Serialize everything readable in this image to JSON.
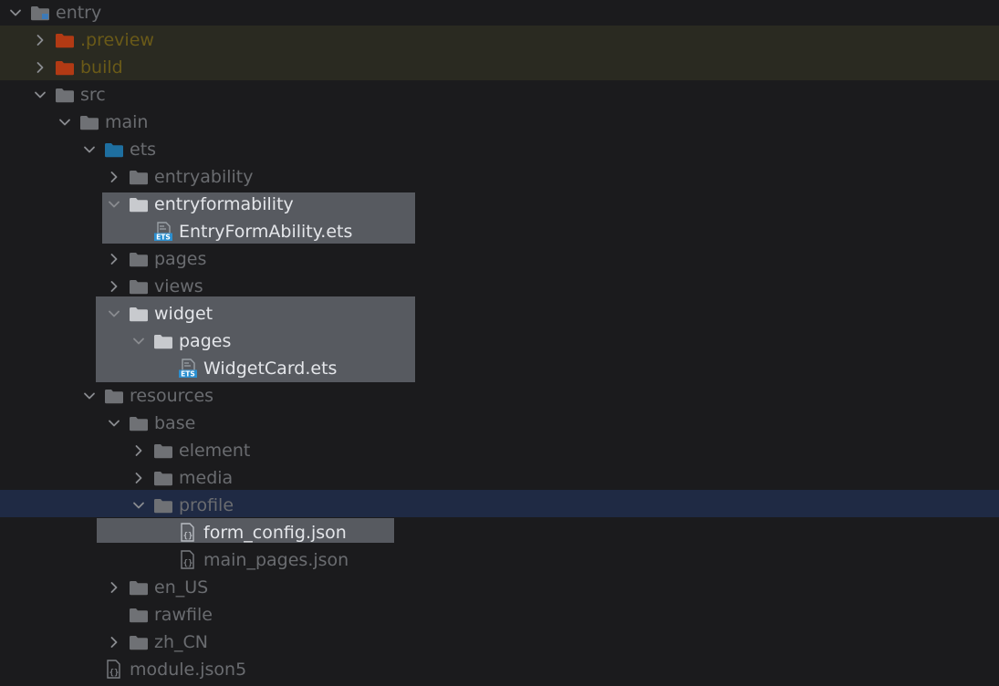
{
  "colors": {
    "background": "#1b1b1d",
    "excluded_band": "#2a2a21",
    "selected_row": "#1f2a44",
    "highlight_box": "#5c5f66",
    "text_dim": "#6a6c70",
    "text_bright": "#e4e6ea",
    "folder_grey": "#6f7175",
    "folder_blue": "#1e6fa0",
    "folder_orange": "#b23a14",
    "ets_badge": "#2b8fd0"
  },
  "tree": [
    {
      "label": "entry",
      "chevron": "down",
      "icon": "module-folder-icon",
      "depth": 0
    },
    {
      "label": ".preview",
      "chevron": "right",
      "icon": "excluded-folder-icon",
      "depth": 1
    },
    {
      "label": "build",
      "chevron": "right",
      "icon": "excluded-folder-icon",
      "depth": 1
    },
    {
      "label": "src",
      "chevron": "down",
      "icon": "folder-icon",
      "depth": 1
    },
    {
      "label": "main",
      "chevron": "down",
      "icon": "folder-icon",
      "depth": 2
    },
    {
      "label": "ets",
      "chevron": "down",
      "icon": "source-folder-icon",
      "depth": 3
    },
    {
      "label": "entryability",
      "chevron": "right",
      "icon": "folder-icon",
      "depth": 4
    },
    {
      "label": "entryformability",
      "chevron": "down",
      "icon": "folder-icon",
      "depth": 4
    },
    {
      "label": "EntryFormAbility.ets",
      "chevron": "none",
      "icon": "ets-file-icon",
      "depth": 5
    },
    {
      "label": "pages",
      "chevron": "right",
      "icon": "folder-icon",
      "depth": 4
    },
    {
      "label": "views",
      "chevron": "right",
      "icon": "folder-icon",
      "depth": 4
    },
    {
      "label": "widget",
      "chevron": "down",
      "icon": "folder-icon",
      "depth": 4
    },
    {
      "label": "pages",
      "chevron": "down",
      "icon": "folder-icon",
      "depth": 5
    },
    {
      "label": "WidgetCard.ets",
      "chevron": "none",
      "icon": "ets-file-icon",
      "depth": 6
    },
    {
      "label": "resources",
      "chevron": "down",
      "icon": "folder-icon",
      "depth": 3
    },
    {
      "label": "base",
      "chevron": "down",
      "icon": "folder-icon",
      "depth": 4
    },
    {
      "label": "element",
      "chevron": "right",
      "icon": "folder-icon",
      "depth": 5
    },
    {
      "label": "media",
      "chevron": "right",
      "icon": "folder-icon",
      "depth": 5
    },
    {
      "label": "profile",
      "chevron": "down",
      "icon": "folder-icon",
      "depth": 5
    },
    {
      "label": "form_config.json",
      "chevron": "none",
      "icon": "json-file-icon",
      "depth": 6
    },
    {
      "label": "main_pages.json",
      "chevron": "none",
      "icon": "json-file-icon",
      "depth": 6
    },
    {
      "label": "en_US",
      "chevron": "right",
      "icon": "folder-icon",
      "depth": 4
    },
    {
      "label": "rawfile",
      "chevron": "none",
      "icon": "folder-icon",
      "depth": 4
    },
    {
      "label": "zh_CN",
      "chevron": "right",
      "icon": "folder-icon",
      "depth": 4
    },
    {
      "label": "module.json5",
      "chevron": "none",
      "icon": "json-file-icon",
      "depth": 3
    }
  ]
}
